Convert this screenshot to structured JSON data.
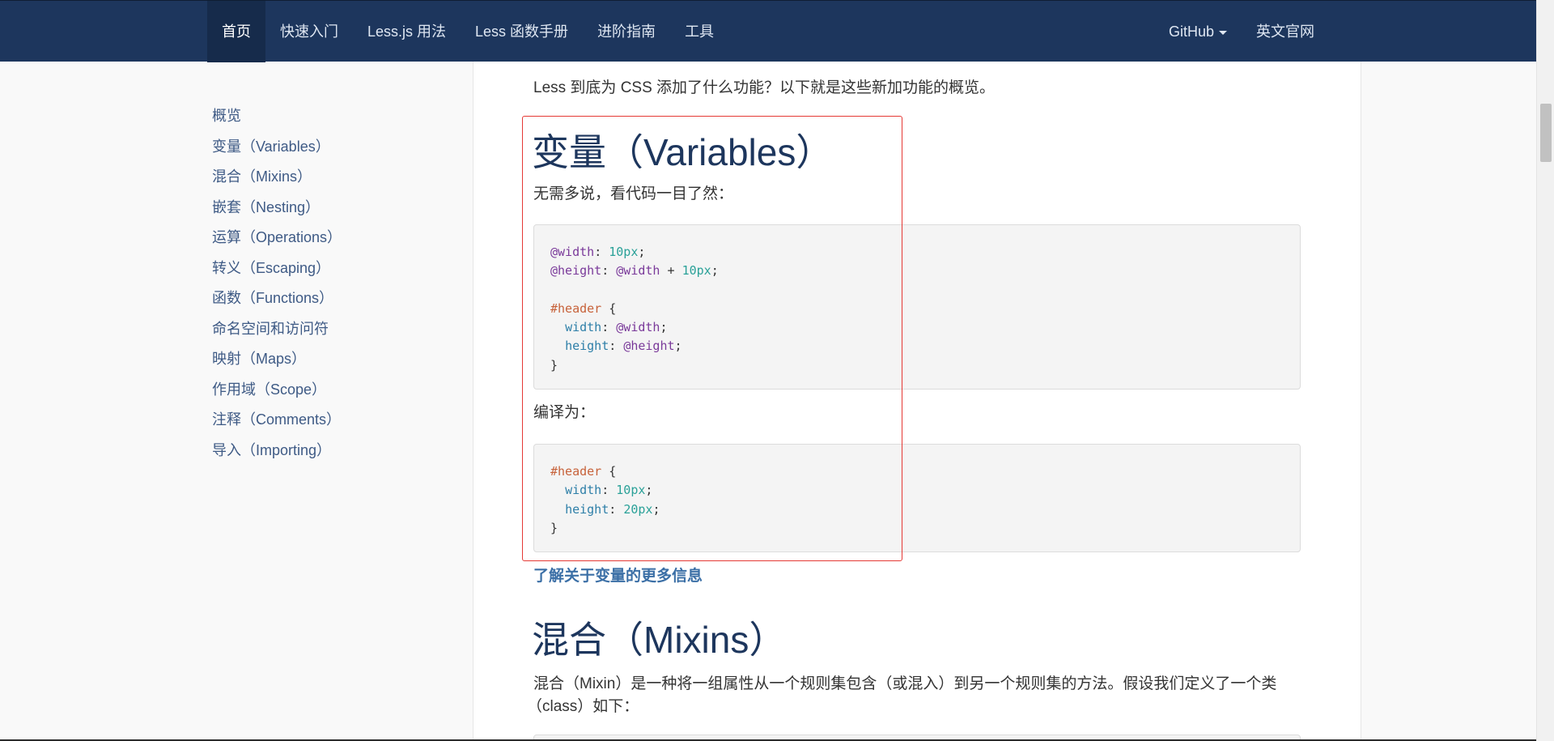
{
  "navbar": {
    "items": [
      {
        "label": "首页",
        "active": true
      },
      {
        "label": "快速入门"
      },
      {
        "label": "Less.js 用法"
      },
      {
        "label": "Less 函数手册"
      },
      {
        "label": "进阶指南"
      },
      {
        "label": "工具"
      }
    ],
    "right": {
      "github_label": "GitHub",
      "english_label": "英文官网"
    }
  },
  "sidebar": {
    "items": [
      {
        "label": "概览"
      },
      {
        "label": "变量（Variables）"
      },
      {
        "label": "混合（Mixins）"
      },
      {
        "label": "嵌套（Nesting）"
      },
      {
        "label": "运算（Operations）"
      },
      {
        "label": "转义（Escaping）"
      },
      {
        "label": "函数（Functions）"
      },
      {
        "label": "命名空间和访问符"
      },
      {
        "label": "映射（Maps）"
      },
      {
        "label": "作用域（Scope）"
      },
      {
        "label": "注释（Comments）"
      },
      {
        "label": "导入（Importing）"
      }
    ]
  },
  "main": {
    "intro": "Less 到底为 CSS 添加了什么功能？以下就是这些新加功能的概览。",
    "variables_heading": "变量（Variables）",
    "variables_desc": "无需多说，看代码一目了然：",
    "compiled_label": "编译为：",
    "more_link": "了解关于变量的更多信息",
    "mixins_heading": "混合（Mixins）",
    "mixins_desc_line1": "混合（Mixin）是一种将一组属性从一个规则集包含（或混入）到另一个规则集的方法。假设我们定义了一个类",
    "mixins_desc_line2": "（class）如下："
  },
  "code1": {
    "l1_var": "@width",
    "l1_colon": ": ",
    "l1_num": "10px",
    "l1_end": ";",
    "l2_var": "@height",
    "l2_colon": ": ",
    "l2_ref": "@width",
    "l2_op": " + ",
    "l2_num": "10px",
    "l2_end": ";",
    "l4_sel": "#header",
    "l4_brace": " {",
    "l5_prop": "width",
    "l5_colon": ": ",
    "l5_ref": "@width",
    "l5_end": ";",
    "l6_prop": "height",
    "l6_colon": ": ",
    "l6_ref": "@height",
    "l6_end": ";",
    "l7_close": "}"
  },
  "code2": {
    "l1_sel": "#header",
    "l1_brace": " {",
    "l2_prop": "width",
    "l2_colon": ": ",
    "l2_num": "10px",
    "l2_end": ";",
    "l3_prop": "height",
    "l3_colon": ": ",
    "l3_num": "20px",
    "l3_end": ";",
    "l4_close": "}"
  },
  "colors": {
    "navbar_bg": "#1d365d",
    "heading": "#1d365d",
    "sidebar_link": "#3e5a85",
    "highlight_box": "#e53935"
  }
}
